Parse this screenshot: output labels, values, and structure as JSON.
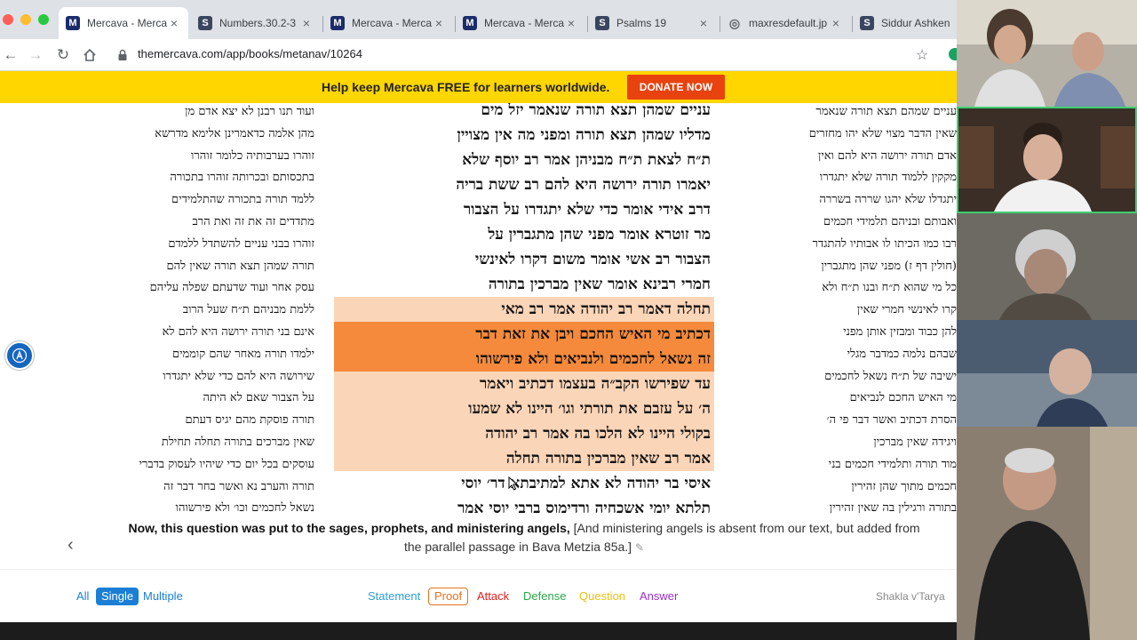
{
  "tabs": [
    {
      "title": "Mercava - Merca",
      "favicon": "M",
      "active": true
    },
    {
      "title": "Numbers.30.2-3",
      "favicon": "S",
      "active": false
    },
    {
      "title": "Mercava - Merca",
      "favicon": "M",
      "active": false
    },
    {
      "title": "Mercava - Merca",
      "favicon": "M",
      "active": false
    },
    {
      "title": "Psalms 19",
      "favicon": "S",
      "active": false
    },
    {
      "title": "maxresdefault.jp",
      "favicon": "globe",
      "active": false
    },
    {
      "title": "Siddur Ashken",
      "favicon": "S",
      "active": false
    }
  ],
  "address": {
    "url": "themercava.com/app/books/metanav/10264"
  },
  "banner": {
    "text": "Help keep Mercava FREE for learners worldwide.",
    "donate_label": "DONATE NOW"
  },
  "text_columns": {
    "left": [
      "ועוד תנו רבנן לא יצא אדם מן",
      "מהן אלמה כדאמרינן אלימא מדרשא",
      "זוהרו בערבותיה כלומר זוהרו",
      "בתכסותם ובכרותה זוהרו בתכורה",
      "ללמד תורה בתכורה שהתלמידים",
      "מתדדים זה את זה ואת הרב",
      "זוהרו בבני עניים להשתדל ללמדם",
      "תורה שמהן תצא תורה שאין להם",
      "עסק אחר ועוד שדעתם שפלה עליהם",
      "ללמת מבניהם ת״ח שעל הרוב",
      "אינם בני תורה ירושה היא להם לא",
      "ילמדו תורה מאחר שהם קוממים",
      "שירושה היא להם כדי שלא יתגדרו",
      "על הצבור שאם לא היתה",
      "תורה פוסקת מהם יגיס דעתם",
      "שאין מברכים בתורה תחלה תחילת",
      "עוסקים בכל יום כדי שיהיו לעסוק בדברי",
      "תורה והערב נא ואשר בחר דבר זה",
      "נשאל לחכמים וכו׳ ולא פירשוהו"
    ],
    "main": [
      "עניים שמהן תצא תורה שנאמר יזל מים",
      "מדליו שמהן תצא תורה ומפני מה אין מצויין",
      "ת״ח לצאת ת״ח מבניהן אמר רב יוסף שלא",
      "יאמרו תורה ירושה היא להם רב ששת בריה",
      "דרב אידי אומר כדי שלא יתגדרו על הצבור",
      "מר זוטרא אומר מפני שהן מתגברין על",
      "הצבור רב אשי אומר משום דקרו לאינשי",
      "חמרי רבינא אומר שאין מברכין בתורה",
      "תחלה דאמר רב יהודה אמר רב מאי",
      "דכתיב מי האיש החכם ויבן את זאת דבר",
      "זה נשאל לחכמים ולנביאים ולא פירשוהו",
      "עד שפירשו הקב״ה בעצמו דכתיב ויאמר",
      "ה׳ על עזבם את תורתי וגו׳ היינו לא שמעו",
      "בקולי היינו לא הלכו בה אמר רב יהודה",
      "אמר רב שאין מברכין בתורה תחלה",
      "איסי בר יהודה לא אתא למתיבתא דר׳ יוסי",
      "תלתא יומי אשכחיה ורדימוס ברבי יוסי אמר"
    ],
    "right": [
      "עניים שמהם תצא תורה שנאמר",
      "שאין הדבר מצוי שלא יהו מחזרים",
      "אדם תורה ירושה היא להם ואין",
      "מקקין ללמוד תורה שלא יתגדרו",
      "יתגדלו שלא יהגו שררה בשררה",
      "ואבותם ובניהם תלמידי חכמים",
      "רבו כמו הכיתו לו אבותיו להתגדר",
      "(חולין דף ז) מפני שהן מתגברין",
      "כל מי שהוא ת״ח ובנו ת״ח ולא",
      "קרו לאינשי חמרי שאין",
      "להן כבוד ומבזין אותן מפני",
      "שבהם נלמה כמדבר מגלי",
      "ישיבה של ת״ח נשאל לחכמים",
      "מי האיש החכם לנביאים",
      "הסרת דכתיב ואשר דבר פי ה׳",
      "ויגידה שאין מברכין",
      "מוד תורה ותלמידי חכמים בני",
      "חכמים מתוך שהן זהירין",
      "בתורה ורגילין בה שאין זהירין"
    ]
  },
  "translation": {
    "bold": "Now, this question was put to the sages, prophets, and ministering angels,",
    "note": "[And ministering angels is absent from our text, but added from the parallel passage in Bava Metzia 85a.]"
  },
  "filters": {
    "mode": {
      "all": "All",
      "single": "Single",
      "multiple": "Multiple"
    },
    "categories": [
      {
        "label": "Statement",
        "color": "#2a9fd6"
      },
      {
        "label": "Proof",
        "color": "#e8701a"
      },
      {
        "label": "Attack",
        "color": "#e02020"
      },
      {
        "label": "Defense",
        "color": "#2aa64a"
      },
      {
        "label": "Question",
        "color": "#e8c010"
      },
      {
        "label": "Answer",
        "color": "#9a30c8"
      }
    ],
    "brand": "Shakla v'Tarya"
  },
  "colors": {
    "banner": "#ffd600",
    "donate": "#e8420f",
    "proof_highlight": "#fbd5b8",
    "proof_strong": "#f58a3c",
    "single_active": "#1a7fd4"
  }
}
